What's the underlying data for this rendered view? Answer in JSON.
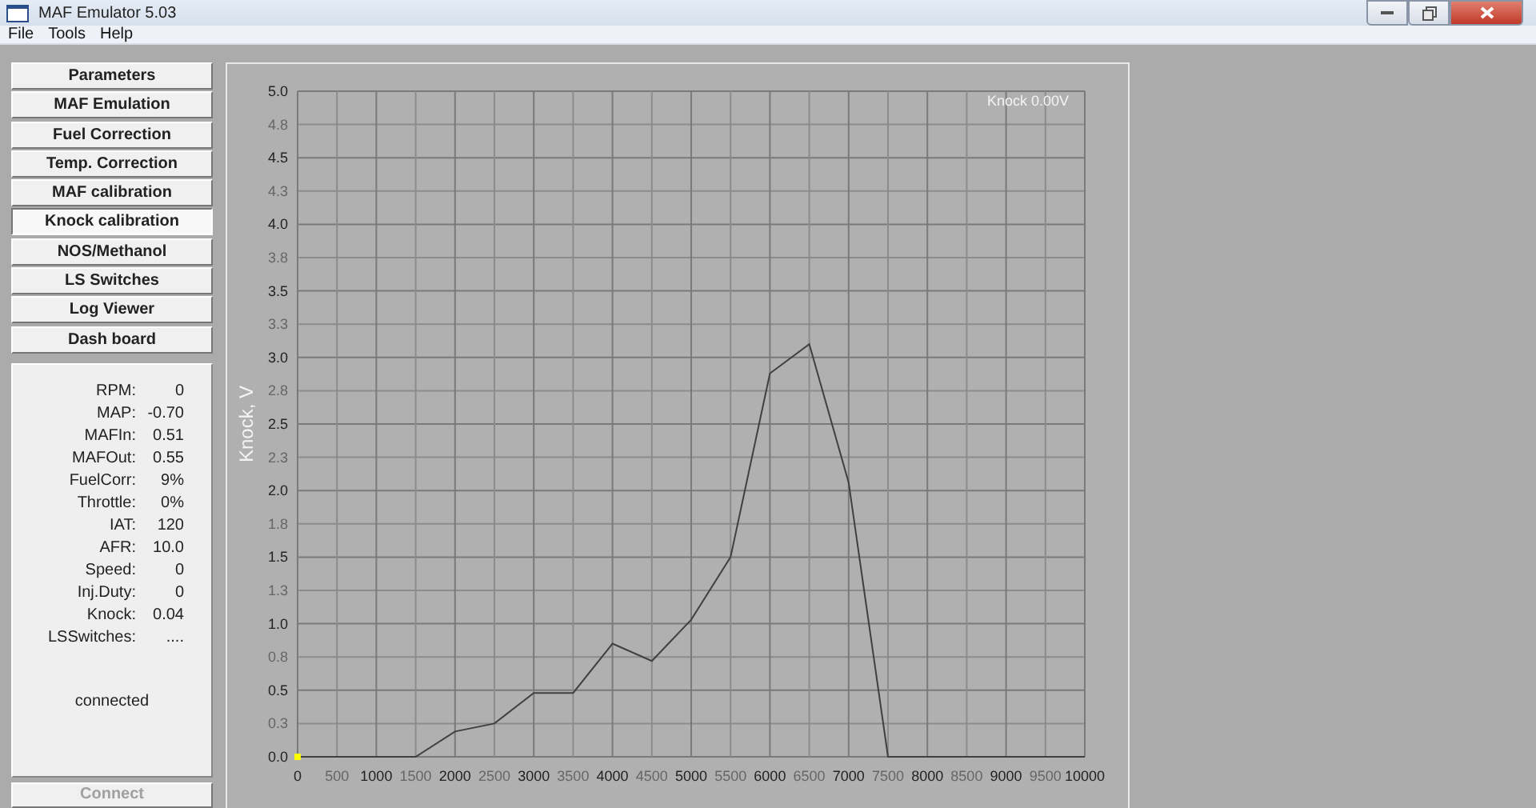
{
  "window": {
    "title": "MAF Emulator 5.03"
  },
  "menu": [
    "File",
    "Tools",
    "Help"
  ],
  "nav": [
    {
      "label": "Parameters",
      "selected": false
    },
    {
      "label": "MAF Emulation",
      "selected": false
    },
    {
      "label": "Fuel Correction",
      "selected": false
    },
    {
      "label": "Temp. Correction",
      "selected": false
    },
    {
      "label": "MAF calibration",
      "selected": false
    },
    {
      "label": "Knock calibration",
      "selected": true
    },
    {
      "label": "NOS/Methanol",
      "selected": false
    },
    {
      "label": "LS Switches",
      "selected": false
    },
    {
      "label": "Log Viewer",
      "selected": false
    },
    {
      "label": "Dash board",
      "selected": false
    }
  ],
  "status": {
    "readings": [
      {
        "label": "RPM:",
        "value": "0"
      },
      {
        "label": "MAP:",
        "value": "-0.70"
      },
      {
        "label": "MAFIn:",
        "value": "0.51"
      },
      {
        "label": "MAFOut:",
        "value": "0.55"
      },
      {
        "label": "FuelCorr:",
        "value": "9%"
      },
      {
        "label": "Throttle:",
        "value": "0%"
      },
      {
        "label": "IAT:",
        "value": "120"
      },
      {
        "label": "AFR:",
        "value": "10.0"
      },
      {
        "label": "Speed:",
        "value": "0"
      },
      {
        "label": "Inj.Duty:",
        "value": "0"
      },
      {
        "label": "Knock:",
        "value": "0.04"
      },
      {
        "label": "LSSwitches:",
        "value": "...."
      }
    ],
    "connection": "connected"
  },
  "connect_button": {
    "label": "Connect",
    "disabled": true
  },
  "chart": {
    "readout": "Knock 0.00V",
    "chart_data": {
      "type": "line",
      "ylabel": "Knock, V",
      "x": [
        0,
        500,
        1000,
        1500,
        2000,
        2500,
        3000,
        3500,
        4000,
        4500,
        5000,
        5500,
        6000,
        6500,
        7000,
        7500,
        8000,
        8500,
        9000,
        9500,
        10000
      ],
      "grid": true,
      "series": [
        {
          "color": "#404040",
          "values": [
            0,
            0,
            0,
            0,
            0.19,
            0.25,
            0.48,
            0.48,
            0.85,
            0.72,
            1.03,
            1.5,
            2.88,
            3.1,
            2.06,
            0,
            0,
            0,
            0,
            0,
            0
          ]
        }
      ],
      "xlim": [
        0,
        10000
      ],
      "ylim": [
        0,
        5
      ],
      "xticks": [
        0,
        500,
        1000,
        1500,
        2000,
        2500,
        3000,
        3500,
        4000,
        4500,
        5000,
        5500,
        6000,
        6500,
        7000,
        7500,
        8000,
        8500,
        9000,
        9500,
        10000
      ],
      "yticks": [
        {
          "value": 0,
          "label": "0.0"
        },
        {
          "value": 0.25,
          "label": "0.3"
        },
        {
          "value": 0.5,
          "label": "0.5"
        },
        {
          "value": 0.75,
          "label": "0.8"
        },
        {
          "value": 1,
          "label": "1.0"
        },
        {
          "value": 1.25,
          "label": "1.3"
        },
        {
          "value": 1.5,
          "label": "1.5"
        },
        {
          "value": 1.75,
          "label": "1.8"
        },
        {
          "value": 2,
          "label": "2.0"
        },
        {
          "value": 2.25,
          "label": "2.3"
        },
        {
          "value": 2.5,
          "label": "2.5"
        },
        {
          "value": 2.75,
          "label": "2.8"
        },
        {
          "value": 3,
          "label": "3.0"
        },
        {
          "value": 3.25,
          "label": "3.3"
        },
        {
          "value": 3.5,
          "label": "3.5"
        },
        {
          "value": 3.75,
          "label": "3.8"
        },
        {
          "value": 4,
          "label": "4.0"
        },
        {
          "value": 4.25,
          "label": "4.3"
        },
        {
          "value": 4.5,
          "label": "4.5"
        },
        {
          "value": 4.75,
          "label": "4.8"
        },
        {
          "value": 5,
          "label": "5.0"
        }
      ]
    }
  }
}
